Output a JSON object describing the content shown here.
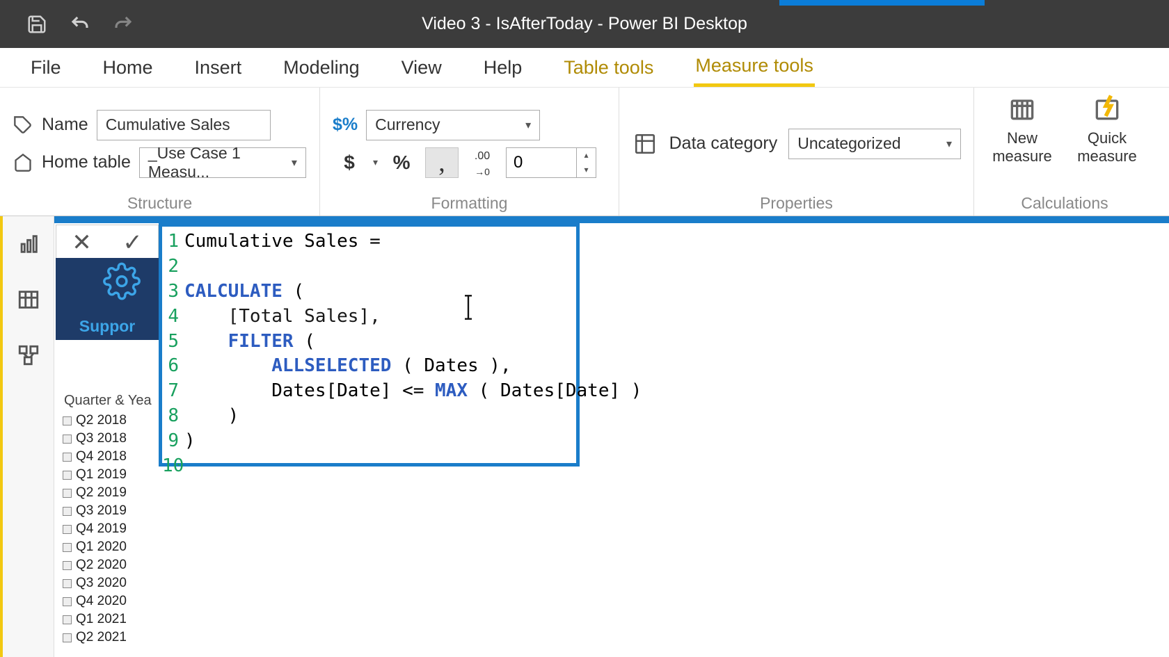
{
  "titleBar": {
    "appTitle": "Video 3 - IsAfterToday - Power BI Desktop"
  },
  "ribbon": {
    "tabs": [
      "File",
      "Home",
      "Insert",
      "Modeling",
      "View",
      "Help",
      "Table tools",
      "Measure tools"
    ],
    "groups": {
      "structure": {
        "label": "Structure",
        "nameLabel": "Name",
        "nameValue": "Cumulative Sales",
        "homeTableLabel": "Home table",
        "homeTableValue": "_Use Case 1 Measu..."
      },
      "formatting": {
        "label": "Formatting",
        "formatValue": "Currency",
        "decimalsValue": "0",
        "currencyBtn": "$",
        "percentBtn": "%",
        "thousandsBtn": ",",
        "decimalsIcon": ".00"
      },
      "properties": {
        "label": "Properties",
        "dataCategoryLabel": "Data category",
        "dataCategoryValue": "Uncategorized"
      },
      "calculations": {
        "label": "Calculations",
        "newMeasure": "New measure",
        "quickMeasure": "Quick measure"
      }
    }
  },
  "formula": {
    "lines": [
      {
        "n": "1",
        "tokens": [
          {
            "t": "Cumulative Sales ="
          }
        ]
      },
      {
        "n": "2",
        "tokens": []
      },
      {
        "n": "3",
        "tokens": [
          {
            "t": "CALCULATE",
            "c": "kw1"
          },
          {
            "t": " ("
          }
        ]
      },
      {
        "n": "4",
        "tokens": [
          {
            "t": "    [Total Sales],",
            "c": "ref"
          }
        ]
      },
      {
        "n": "5",
        "tokens": [
          {
            "t": "    "
          },
          {
            "t": "FILTER",
            "c": "kw1"
          },
          {
            "t": " ("
          }
        ]
      },
      {
        "n": "6",
        "tokens": [
          {
            "t": "        "
          },
          {
            "t": "ALLSELECTED",
            "c": "kw1"
          },
          {
            "t": " ( Dates ),"
          }
        ]
      },
      {
        "n": "7",
        "tokens": [
          {
            "t": "        Dates[Date] <= "
          },
          {
            "t": "MAX",
            "c": "kw1"
          },
          {
            "t": " ( Dates[Date] )"
          }
        ]
      },
      {
        "n": "8",
        "tokens": [
          {
            "t": "    )"
          }
        ]
      },
      {
        "n": "9",
        "tokens": [
          {
            "t": ")"
          }
        ]
      },
      {
        "n": "10",
        "tokens": []
      }
    ]
  },
  "supportCard": {
    "label": "Suppor"
  },
  "slicer": {
    "header": "Quarter & Year",
    "items": [
      "Q2 2018",
      "Q3 2018",
      "Q4 2018",
      "Q1 2019",
      "Q2 2019",
      "Q3 2019",
      "Q4 2019",
      "Q1 2020",
      "Q2 2020",
      "Q3 2020",
      "Q4 2020",
      "Q1 2021",
      "Q2 2021"
    ]
  }
}
